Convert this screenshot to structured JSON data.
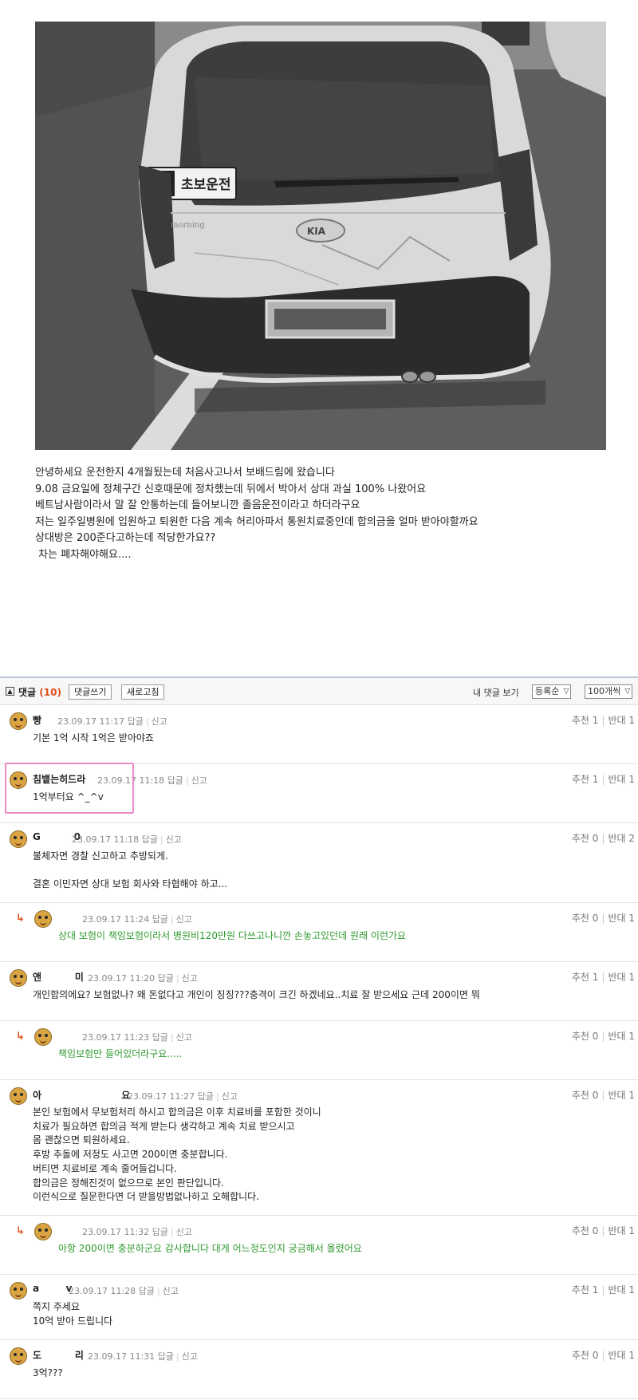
{
  "article": {
    "photo": {
      "sticker_text": "초보운전",
      "badge_text": "KIA",
      "model_text": "morning"
    },
    "body_lines": [
      "안녕하세요 운전한지 4개월됬는데 처음사고나서 보배드림에 왔습니다",
      "9.08 금요일에 정체구간 신호때문에 정차했는데 뒤에서 박아서 상대 과실 100% 나왔어요",
      "베트남사람이라서 말 잘 안통하는데 들어보니깐 졸음운전이라고 하더라구요",
      "저는 일주일병원에 입원하고 퇴원한 다음 계속 허리아파서 통원치료중인데 합의금을 얼마 받아야할까요",
      "상대방은 200준다고하는데 적당한가요??",
      " 차는 폐차해야해요...."
    ]
  },
  "comment_bar": {
    "icon": "▲",
    "title": "댓글",
    "count": "(10)",
    "write_button": "댓글쓰기",
    "refresh_button": "새로고침",
    "my_comments": "내 댓글 보기",
    "sort_select": "등록순",
    "per_page_select": "100개씩"
  },
  "comments": [
    {
      "nick": "빵",
      "date": "23.09.17 11:17",
      "reply": "답글",
      "report": "신고",
      "up": "추천 1",
      "down": "반대 1",
      "text": "기본 1억 시작 1억은 받아야죠"
    },
    {
      "nick": "침뱉는히드라",
      "date": "23.09.17 11:18",
      "reply": "답글",
      "report": "신고",
      "up": "추천 1",
      "down": "반대 1",
      "text": "1억부터요 ^_^v"
    },
    {
      "nick": "G          0",
      "date": "23.09.17 11:18",
      "reply": "답글",
      "report": "신고",
      "up": "추천 0",
      "down": "반대 2",
      "text": "불체자면 경찰 신고하고 추방되게.\n\n결혼 이민자면 상대 보험 회사와 타협해야 하고..."
    },
    {
      "nick": "",
      "date": "23.09.17 11:24",
      "reply": "답글",
      "report": "신고",
      "up": "추천 0",
      "down": "반대 1",
      "text": "상대 보험이 책임보험이라서 병원비120만원 다쓰고나니깐 손놓고있던데 원래 이런가요"
    },
    {
      "nick": "앤          미",
      "date": "23.09.17 11:20",
      "reply": "답글",
      "report": "신고",
      "up": "추천 1",
      "down": "반대 1",
      "text": "개인합의에요? 보험없나? 왜 돈없다고 개인이 징징???충격이 크긴 하겠네요..치료 잘 받으세요 근데 200이면 뭐"
    },
    {
      "nick": "",
      "date": "23.09.17 11:23",
      "reply": "답글",
      "report": "신고",
      "up": "추천 0",
      "down": "반대 1",
      "text": "책임보험만 들어있더라구요....."
    },
    {
      "nick": "아                        요",
      "date": "23.09.17 11:27",
      "reply": "답글",
      "report": "신고",
      "up": "추천 0",
      "down": "반대 1",
      "text": "본인 보험에서 무보험처리 하시고 합의금은 이후 치료비를 포함한 것이니\n치료가 필요하면 합의금 적게 받는다 생각하고 계속 치료 받으시고\n몸 괜찮으면 퇴원하세요.\n후방 추돌에 저정도 사고면 200이면 충분합니다.\n버티면 치료비로 계속 줄어들겁니다.\n합의금은 정해진것이 없으므로 본인 판단입니다.\n이런식으로 질문한다면 더 받을방법없나하고 오해합니다."
    },
    {
      "nick": "",
      "date": "23.09.17 11:32",
      "reply": "답글",
      "report": "신고",
      "up": "추천 0",
      "down": "반대 1",
      "text": "아항 200이면 충분하군요 감사합니다 대게 어느정도인지 궁금해서 올렸어요"
    },
    {
      "nick": "a        v",
      "date": "23.09.17 11:28",
      "reply": "답글",
      "report": "신고",
      "up": "추천 1",
      "down": "반대 1",
      "text": "쪽지 주세요\n10억 받아 드립니다"
    },
    {
      "nick": "도          리",
      "date": "23.09.17 11:31",
      "reply": "답글",
      "report": "신고",
      "up": "추천 0",
      "down": "반대 1",
      "text": "3억???"
    }
  ]
}
